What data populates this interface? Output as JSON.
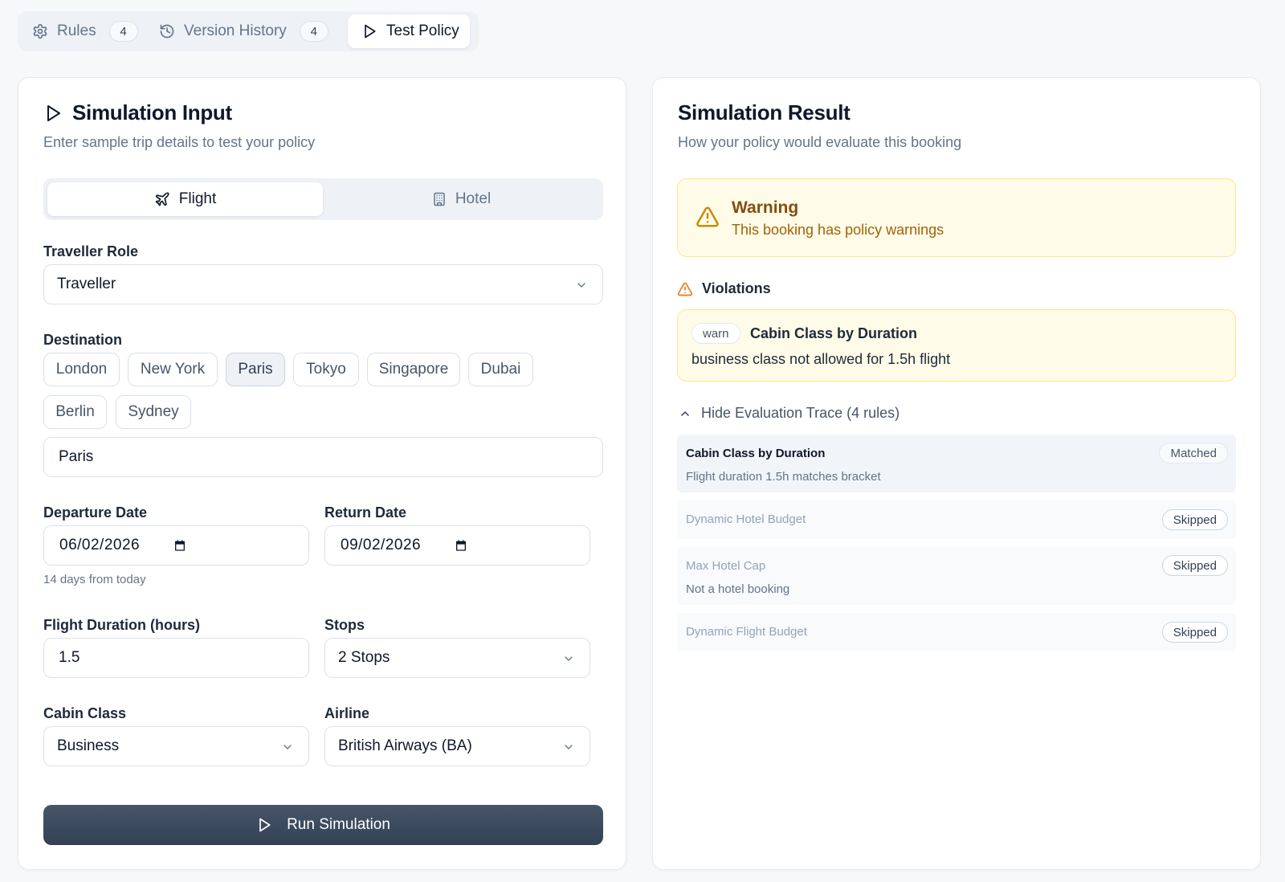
{
  "tabs": {
    "rules": {
      "label": "Rules",
      "count": "4"
    },
    "history": {
      "label": "Version History",
      "count": "4"
    },
    "test": {
      "label": "Test Policy"
    }
  },
  "input": {
    "title": "Simulation Input",
    "subtitle": "Enter sample trip details to test your policy",
    "mode": {
      "flight": "Flight",
      "hotel": "Hotel",
      "selected": "Flight"
    },
    "traveller_role": {
      "label": "Traveller Role",
      "value": "Traveller"
    },
    "destination": {
      "label": "Destination",
      "chips": [
        "London",
        "New York",
        "Paris",
        "Tokyo",
        "Singapore",
        "Dubai",
        "Berlin",
        "Sydney"
      ],
      "selected": "Paris",
      "value": "Paris"
    },
    "departure": {
      "label": "Departure Date",
      "value": "06/02/2026",
      "hint": "14 days from today"
    },
    "return": {
      "label": "Return Date",
      "value": "09/02/2026"
    },
    "duration": {
      "label": "Flight Duration (hours)",
      "value": "1.5"
    },
    "stops": {
      "label": "Stops",
      "value": "2 Stops"
    },
    "cabin": {
      "label": "Cabin Class",
      "value": "Business"
    },
    "airline": {
      "label": "Airline",
      "value": "British Airways (BA)"
    },
    "run_label": "Run Simulation"
  },
  "result": {
    "title": "Simulation Result",
    "subtitle": "How your policy would evaluate this booking",
    "status": {
      "title": "Warning",
      "text": "This booking has policy warnings",
      "color": "#ca8a04"
    },
    "violations_label": "Violations",
    "violations": [
      {
        "severity": "warn",
        "rule": "Cabin Class by Duration",
        "message": "business class not allowed for 1.5h flight"
      }
    ],
    "trace_toggle": "Hide Evaluation Trace (4 rules)",
    "trace": [
      {
        "name": "Cabin Class by Duration",
        "detail": "Flight duration 1.5h matches bracket",
        "status": "Matched"
      },
      {
        "name": "Dynamic Hotel Budget",
        "detail": "",
        "status": "Skipped"
      },
      {
        "name": "Max Hotel Cap",
        "detail": "Not a hotel booking",
        "status": "Skipped"
      },
      {
        "name": "Dynamic Flight Budget",
        "detail": "",
        "status": "Skipped"
      }
    ]
  }
}
